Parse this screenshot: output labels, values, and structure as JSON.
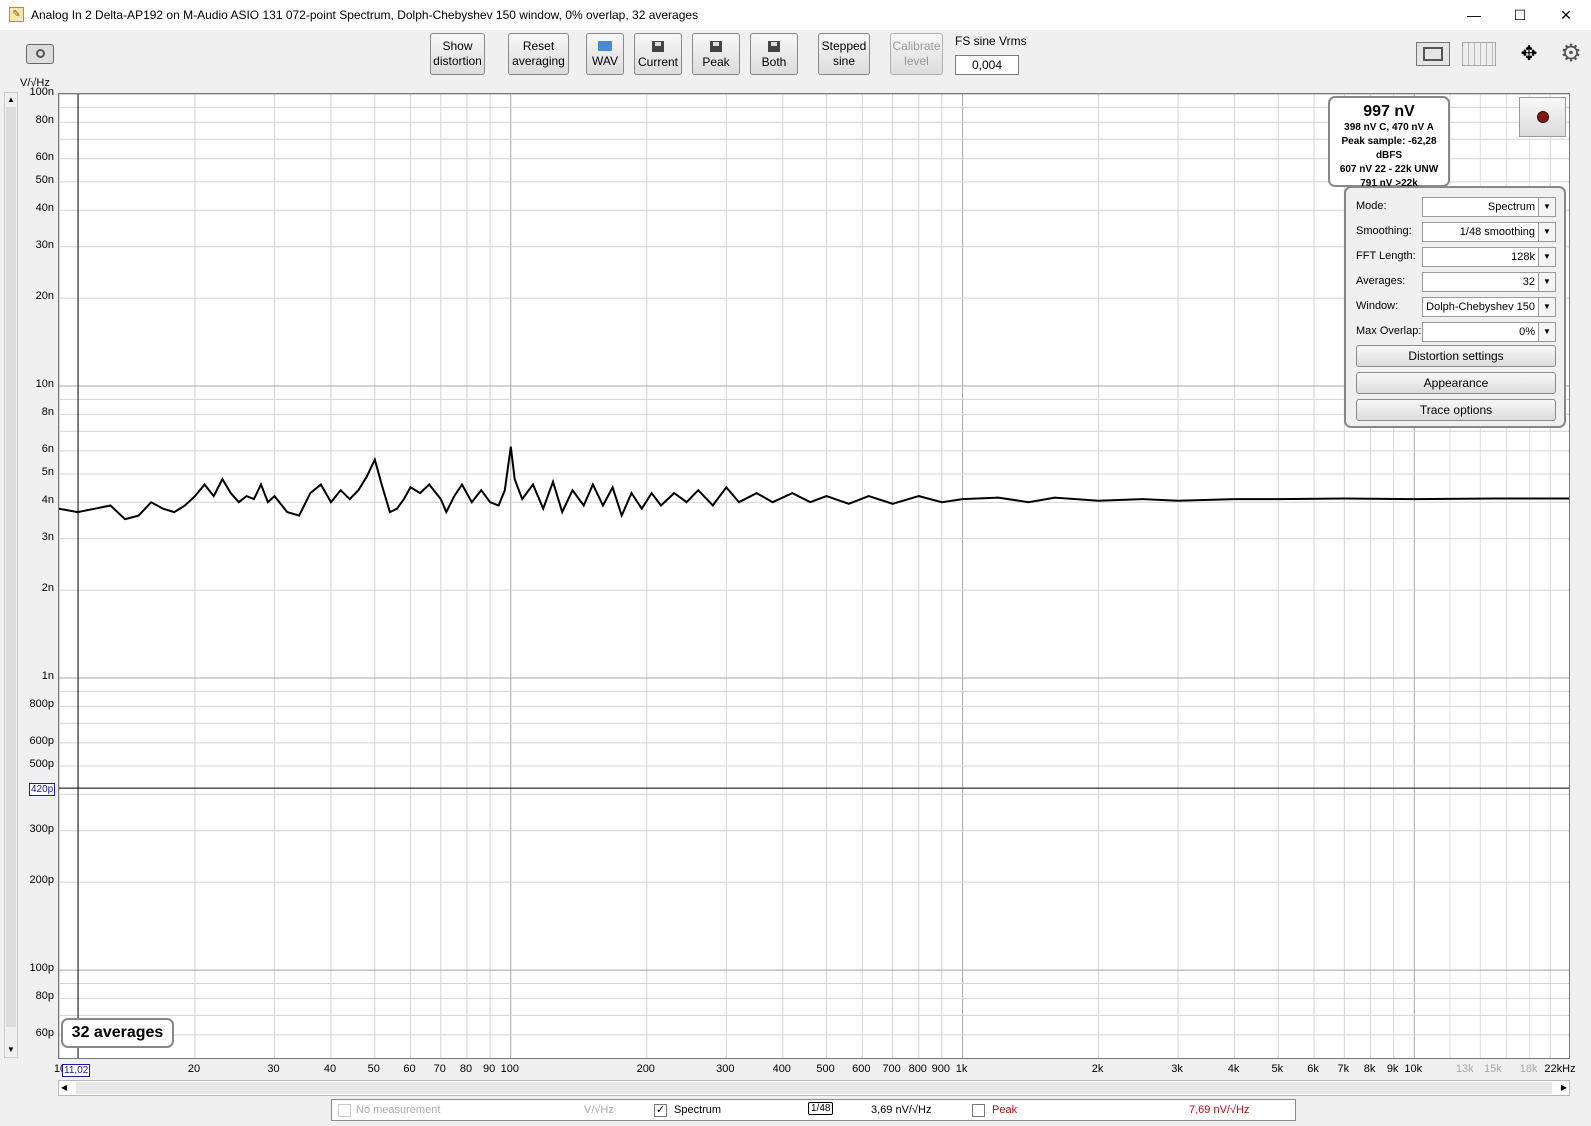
{
  "window": {
    "title": "Analog In 2 Delta-AP192 on M-Audio ASIO 131 072-point Spectrum, Dolph-Chebyshev 150 window, 0% overlap, 32 averages",
    "minimize": "—",
    "maximize": "☐",
    "close": "✕"
  },
  "toolbar": {
    "show_distortion": [
      "Show",
      "distortion"
    ],
    "reset_averaging": [
      "Reset",
      "averaging"
    ],
    "wav": "WAV",
    "current": "Current",
    "peak": "Peak",
    "both": "Both",
    "stepped_sine": [
      "Stepped",
      "sine"
    ],
    "calibrate_level": [
      "Calibrate",
      "level"
    ],
    "fs_sine_label": "FS sine Vrms",
    "fs_sine_value": "0,004"
  },
  "readout": {
    "main": "997 nV",
    "lines": [
      "398 nV C, 470 nV A",
      "Peak sample: -62,28 dBFS",
      "607 nV 22 - 22k UNW",
      "791 nV >22k"
    ]
  },
  "controls": {
    "rows": [
      {
        "label": "Mode:",
        "value": "Spectrum"
      },
      {
        "label": "Smoothing:",
        "value": "1/48 smoothing"
      },
      {
        "label": "FFT Length:",
        "value": "128k"
      },
      {
        "label": "Averages:",
        "value": "32"
      },
      {
        "label": "Window:",
        "value": "Dolph-Chebyshev 150"
      },
      {
        "label": "Max Overlap:",
        "value": "0%"
      }
    ],
    "buttons": [
      "Distortion settings",
      "Appearance",
      "Trace options"
    ]
  },
  "averages_badge": "32 averages",
  "legend": {
    "no_measurement": "No measurement",
    "unit_dim": "V/√Hz",
    "spectrum": "Spectrum",
    "smoothing": "1/48",
    "spectrum_value": "3,69 nV/√Hz",
    "peak": "Peak",
    "peak_value": "7,69 nV/√Hz"
  },
  "cursor": {
    "x_value": "11,02",
    "y_value": "420p"
  },
  "colors": {
    "trace": "#000000",
    "peak_text": "#b01010",
    "cursor_box": "#1a1aa8"
  },
  "chart_data": {
    "type": "line",
    "yunit": "V/√Hz",
    "xunit": "kHz",
    "xscale": "log",
    "yscale": "log",
    "xlim": [
      10,
      22000
    ],
    "ylim": [
      5e-11,
      1e-07
    ],
    "grid": true,
    "yticks": [
      {
        "v": 1e-07,
        "t": "100n"
      },
      {
        "v": 8e-08,
        "t": "80n"
      },
      {
        "v": 6e-08,
        "t": "60n"
      },
      {
        "v": 5e-08,
        "t": "50n"
      },
      {
        "v": 4e-08,
        "t": "40n"
      },
      {
        "v": 3e-08,
        "t": "30n"
      },
      {
        "v": 2e-08,
        "t": "20n"
      },
      {
        "v": 1e-08,
        "t": "10n"
      },
      {
        "v": 8e-09,
        "t": "8n"
      },
      {
        "v": 6e-09,
        "t": "6n"
      },
      {
        "v": 5e-09,
        "t": "5n"
      },
      {
        "v": 4e-09,
        "t": "4n"
      },
      {
        "v": 3e-09,
        "t": "3n"
      },
      {
        "v": 2e-09,
        "t": "2n"
      },
      {
        "v": 1e-09,
        "t": "1n"
      },
      {
        "v": 8e-10,
        "t": "800p"
      },
      {
        "v": 6e-10,
        "t": "600p"
      },
      {
        "v": 5e-10,
        "t": "500p"
      },
      {
        "v": 3e-10,
        "t": "300p"
      },
      {
        "v": 2e-10,
        "t": "200p"
      },
      {
        "v": 1e-10,
        "t": "100p"
      },
      {
        "v": 8e-11,
        "t": "80p"
      },
      {
        "v": 6e-11,
        "t": "60p"
      }
    ],
    "xticks": [
      {
        "v": 10,
        "t": "10"
      },
      {
        "v": 20,
        "t": "20"
      },
      {
        "v": 30,
        "t": "30"
      },
      {
        "v": 40,
        "t": "40"
      },
      {
        "v": 50,
        "t": "50"
      },
      {
        "v": 60,
        "t": "60"
      },
      {
        "v": 70,
        "t": "70"
      },
      {
        "v": 80,
        "t": "80"
      },
      {
        "v": 90,
        "t": "90"
      },
      {
        "v": 100,
        "t": "100"
      },
      {
        "v": 200,
        "t": "200"
      },
      {
        "v": 300,
        "t": "300"
      },
      {
        "v": 400,
        "t": "400"
      },
      {
        "v": 500,
        "t": "500"
      },
      {
        "v": 600,
        "t": "600"
      },
      {
        "v": 700,
        "t": "700"
      },
      {
        "v": 800,
        "t": "800"
      },
      {
        "v": 900,
        "t": "900"
      },
      {
        "v": 1000,
        "t": "1k"
      },
      {
        "v": 2000,
        "t": "2k"
      },
      {
        "v": 3000,
        "t": "3k"
      },
      {
        "v": 4000,
        "t": "4k"
      },
      {
        "v": 5000,
        "t": "5k"
      },
      {
        "v": 6000,
        "t": "6k"
      },
      {
        "v": 7000,
        "t": "7k"
      },
      {
        "v": 8000,
        "t": "8k"
      },
      {
        "v": 9000,
        "t": "9k"
      },
      {
        "v": 10000,
        "t": "10k"
      },
      {
        "v": 13000,
        "t": "13k",
        "faded": true
      },
      {
        "v": 15000,
        "t": "15k",
        "faded": true
      },
      {
        "v": 18000,
        "t": "18k",
        "faded": true
      },
      {
        "v": 22000,
        "t": "22kHz"
      }
    ],
    "series": [
      {
        "values": [
          [
            10,
            3.8e-09
          ],
          [
            11,
            3.7e-09
          ],
          [
            12,
            3.8e-09
          ],
          [
            13,
            3.9e-09
          ],
          [
            14,
            3.5e-09
          ],
          [
            15,
            3.6e-09
          ],
          [
            16,
            4e-09
          ],
          [
            17,
            3.8e-09
          ],
          [
            18,
            3.7e-09
          ],
          [
            19,
            3.9e-09
          ],
          [
            20,
            4.2e-09
          ],
          [
            21,
            4.6e-09
          ],
          [
            22,
            4.2e-09
          ],
          [
            23,
            4.8e-09
          ],
          [
            24,
            4.3e-09
          ],
          [
            25,
            4e-09
          ],
          [
            26,
            4.2e-09
          ],
          [
            27,
            4.1e-09
          ],
          [
            28,
            4.6e-09
          ],
          [
            29,
            4e-09
          ],
          [
            30,
            4.2e-09
          ],
          [
            32,
            3.7e-09
          ],
          [
            34,
            3.6e-09
          ],
          [
            36,
            4.3e-09
          ],
          [
            38,
            4.6e-09
          ],
          [
            40,
            4e-09
          ],
          [
            42,
            4.4e-09
          ],
          [
            44,
            4.1e-09
          ],
          [
            46,
            4.4e-09
          ],
          [
            48,
            4.9e-09
          ],
          [
            50,
            5.6e-09
          ],
          [
            52,
            4.5e-09
          ],
          [
            54,
            3.7e-09
          ],
          [
            56,
            3.8e-09
          ],
          [
            58,
            4.1e-09
          ],
          [
            60,
            4.5e-09
          ],
          [
            63,
            4.3e-09
          ],
          [
            66,
            4.6e-09
          ],
          [
            70,
            4.1e-09
          ],
          [
            72,
            3.7e-09
          ],
          [
            75,
            4.2e-09
          ],
          [
            78,
            4.6e-09
          ],
          [
            82,
            4e-09
          ],
          [
            86,
            4.4e-09
          ],
          [
            90,
            4e-09
          ],
          [
            94,
            3.9e-09
          ],
          [
            97,
            4.4e-09
          ],
          [
            100,
            6.2e-09
          ],
          [
            102,
            4.8e-09
          ],
          [
            106,
            4.1e-09
          ],
          [
            112,
            4.6e-09
          ],
          [
            118,
            3.8e-09
          ],
          [
            124,
            4.7e-09
          ],
          [
            130,
            3.7e-09
          ],
          [
            137,
            4.4e-09
          ],
          [
            145,
            3.9e-09
          ],
          [
            152,
            4.6e-09
          ],
          [
            160,
            3.9e-09
          ],
          [
            168,
            4.5e-09
          ],
          [
            176,
            3.6e-09
          ],
          [
            185,
            4.3e-09
          ],
          [
            195,
            3.8e-09
          ],
          [
            205,
            4.3e-09
          ],
          [
            215,
            3.9e-09
          ],
          [
            230,
            4.3e-09
          ],
          [
            245,
            4e-09
          ],
          [
            260,
            4.4e-09
          ],
          [
            280,
            3.9e-09
          ],
          [
            300,
            4.5e-09
          ],
          [
            320,
            4e-09
          ],
          [
            350,
            4.3e-09
          ],
          [
            380,
            4e-09
          ],
          [
            420,
            4.3e-09
          ],
          [
            460,
            4e-09
          ],
          [
            500,
            4.2e-09
          ],
          [
            560,
            3.95e-09
          ],
          [
            620,
            4.2e-09
          ],
          [
            700,
            3.95e-09
          ],
          [
            800,
            4.2e-09
          ],
          [
            900,
            4e-09
          ],
          [
            1000,
            4.1e-09
          ],
          [
            1200,
            4.15e-09
          ],
          [
            1400,
            4e-09
          ],
          [
            1600,
            4.15e-09
          ],
          [
            2000,
            4.05e-09
          ],
          [
            2500,
            4.1e-09
          ],
          [
            3000,
            4.05e-09
          ],
          [
            4000,
            4.1e-09
          ],
          [
            5000,
            4.1e-09
          ],
          [
            7000,
            4.12e-09
          ],
          [
            10000,
            4.1e-09
          ],
          [
            15000,
            4.12e-09
          ],
          [
            22000,
            4.12e-09
          ]
        ]
      }
    ]
  }
}
